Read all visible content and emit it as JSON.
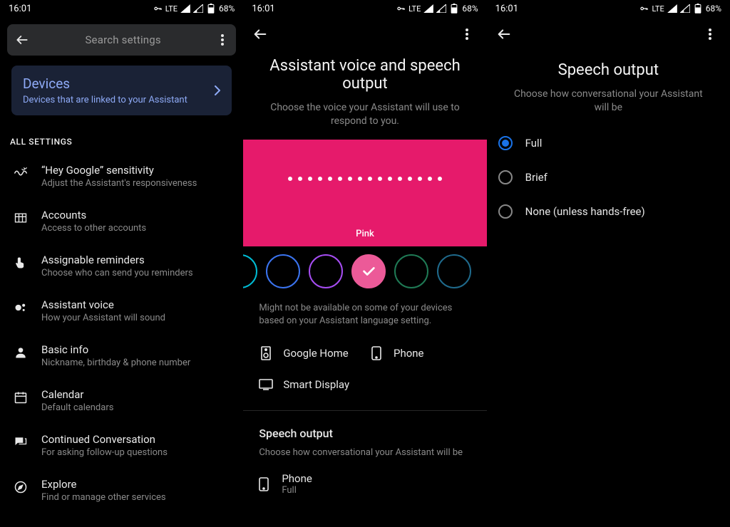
{
  "status": {
    "time": "16:01",
    "net": "LTE",
    "battery": "68%"
  },
  "pane1": {
    "search_placeholder": "Search settings",
    "devices": {
      "title": "Devices",
      "subtitle": "Devices that are linked to your Assistant"
    },
    "section": "ALL SETTINGS",
    "items": [
      {
        "title": "“Hey Google” sensitivity",
        "sub": "Adjust the Assistant's responsiveness"
      },
      {
        "title": "Accounts",
        "sub": "Access to other accounts"
      },
      {
        "title": "Assignable reminders",
        "sub": "Choose who can send you reminders"
      },
      {
        "title": "Assistant voice",
        "sub": "How your Assistant will sound"
      },
      {
        "title": "Basic info",
        "sub": "Nickname, birthday & phone number"
      },
      {
        "title": "Calendar",
        "sub": "Default calendars"
      },
      {
        "title": "Continued Conversation",
        "sub": "For asking follow-up questions"
      },
      {
        "title": "Explore",
        "sub": "Find or manage other services"
      }
    ]
  },
  "pane2": {
    "title": "Assistant voice and speech output",
    "desc": "Choose the voice your Assistant will use to respond to you.",
    "swatch_label": "Pink",
    "swatch_colors": [
      "#00bcd4",
      "#3b74f0",
      "#a64df2",
      "#ec5a98",
      "#1f7a55",
      "#1f6a8c"
    ],
    "note": "Might not be available on some of your devices based on your Assistant language setting.",
    "devices": {
      "google_home": "Google Home",
      "phone": "Phone",
      "smart_display": "Smart Display"
    },
    "speech": {
      "label": "Speech output",
      "sub": "Choose how conversational your Assistant will be",
      "item_title": "Phone",
      "item_sub": "Full"
    }
  },
  "pane3": {
    "title": "Speech output",
    "desc": "Choose how conversational your Assistant will be",
    "options": {
      "full": "Full",
      "brief": "Brief",
      "none": "None (unless hands-free)"
    }
  }
}
